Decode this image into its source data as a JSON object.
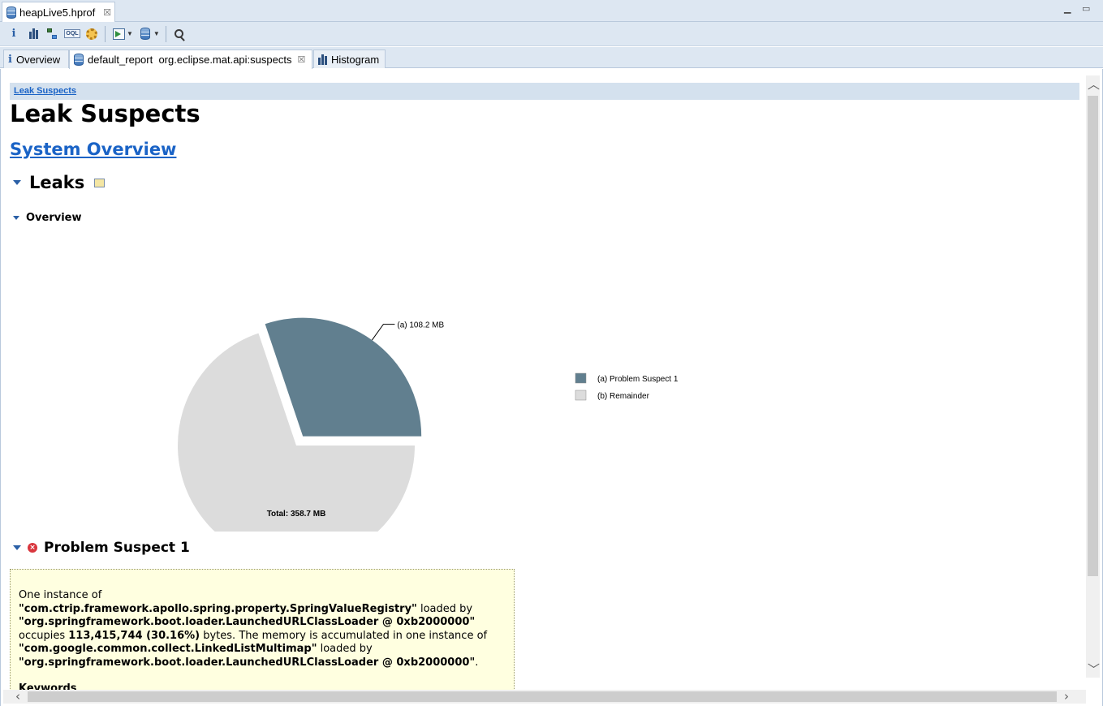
{
  "editor": {
    "file_tab": "heapLive5.hprof"
  },
  "tabs": [
    {
      "label": "Overview"
    },
    {
      "label": "default_report  org.eclipse.mat.api:suspects"
    },
    {
      "label": "Histogram"
    }
  ],
  "report": {
    "breadcrumb": "Leak Suspects",
    "title": "Leak Suspects",
    "system_overview_link": "System Overview",
    "leaks_heading": "Leaks",
    "overview_heading": "Overview",
    "problem_heading": "Problem Suspect 1"
  },
  "chart_data": {
    "type": "pie",
    "slices": [
      {
        "label": "(a)",
        "name": "Problem Suspect 1",
        "value_mb": 108.2,
        "value_text": "108.2 MB",
        "color": "#617f8f",
        "exploded": true
      },
      {
        "label": "(b)",
        "name": "Remainder",
        "value_mb": 250.5,
        "value_text": "250.5 MB",
        "color": "#dcdcdc",
        "exploded": false
      }
    ],
    "total_text": "Total: 358.7 MB",
    "legend": [
      "(a)  Problem Suspect 1",
      "(b)  Remainder"
    ],
    "legend_position": "right"
  },
  "suspect": {
    "line1": "One instance of",
    "class_name": "\"com.ctrip.framework.apollo.spring.property.SpringValueRegistry\"",
    "loaded_by_1": " loaded by",
    "loader_1": "\"org.springframework.boot.loader.LaunchedURLClassLoader @ 0xb2000000\"",
    "occupies": "occupies ",
    "bytes_value": "113,415,744 (30.16%)",
    "bytes_rest": " bytes. The memory is accumulated in one instance of",
    "acc_class": "\"com.google.common.collect.LinkedListMultimap\"",
    "loaded_by_2": " loaded by",
    "loader_2": "\"org.springframework.boot.loader.LaunchedURLClassLoader @ 0xb2000000\"",
    "period": ".",
    "keywords": "Keywords"
  }
}
